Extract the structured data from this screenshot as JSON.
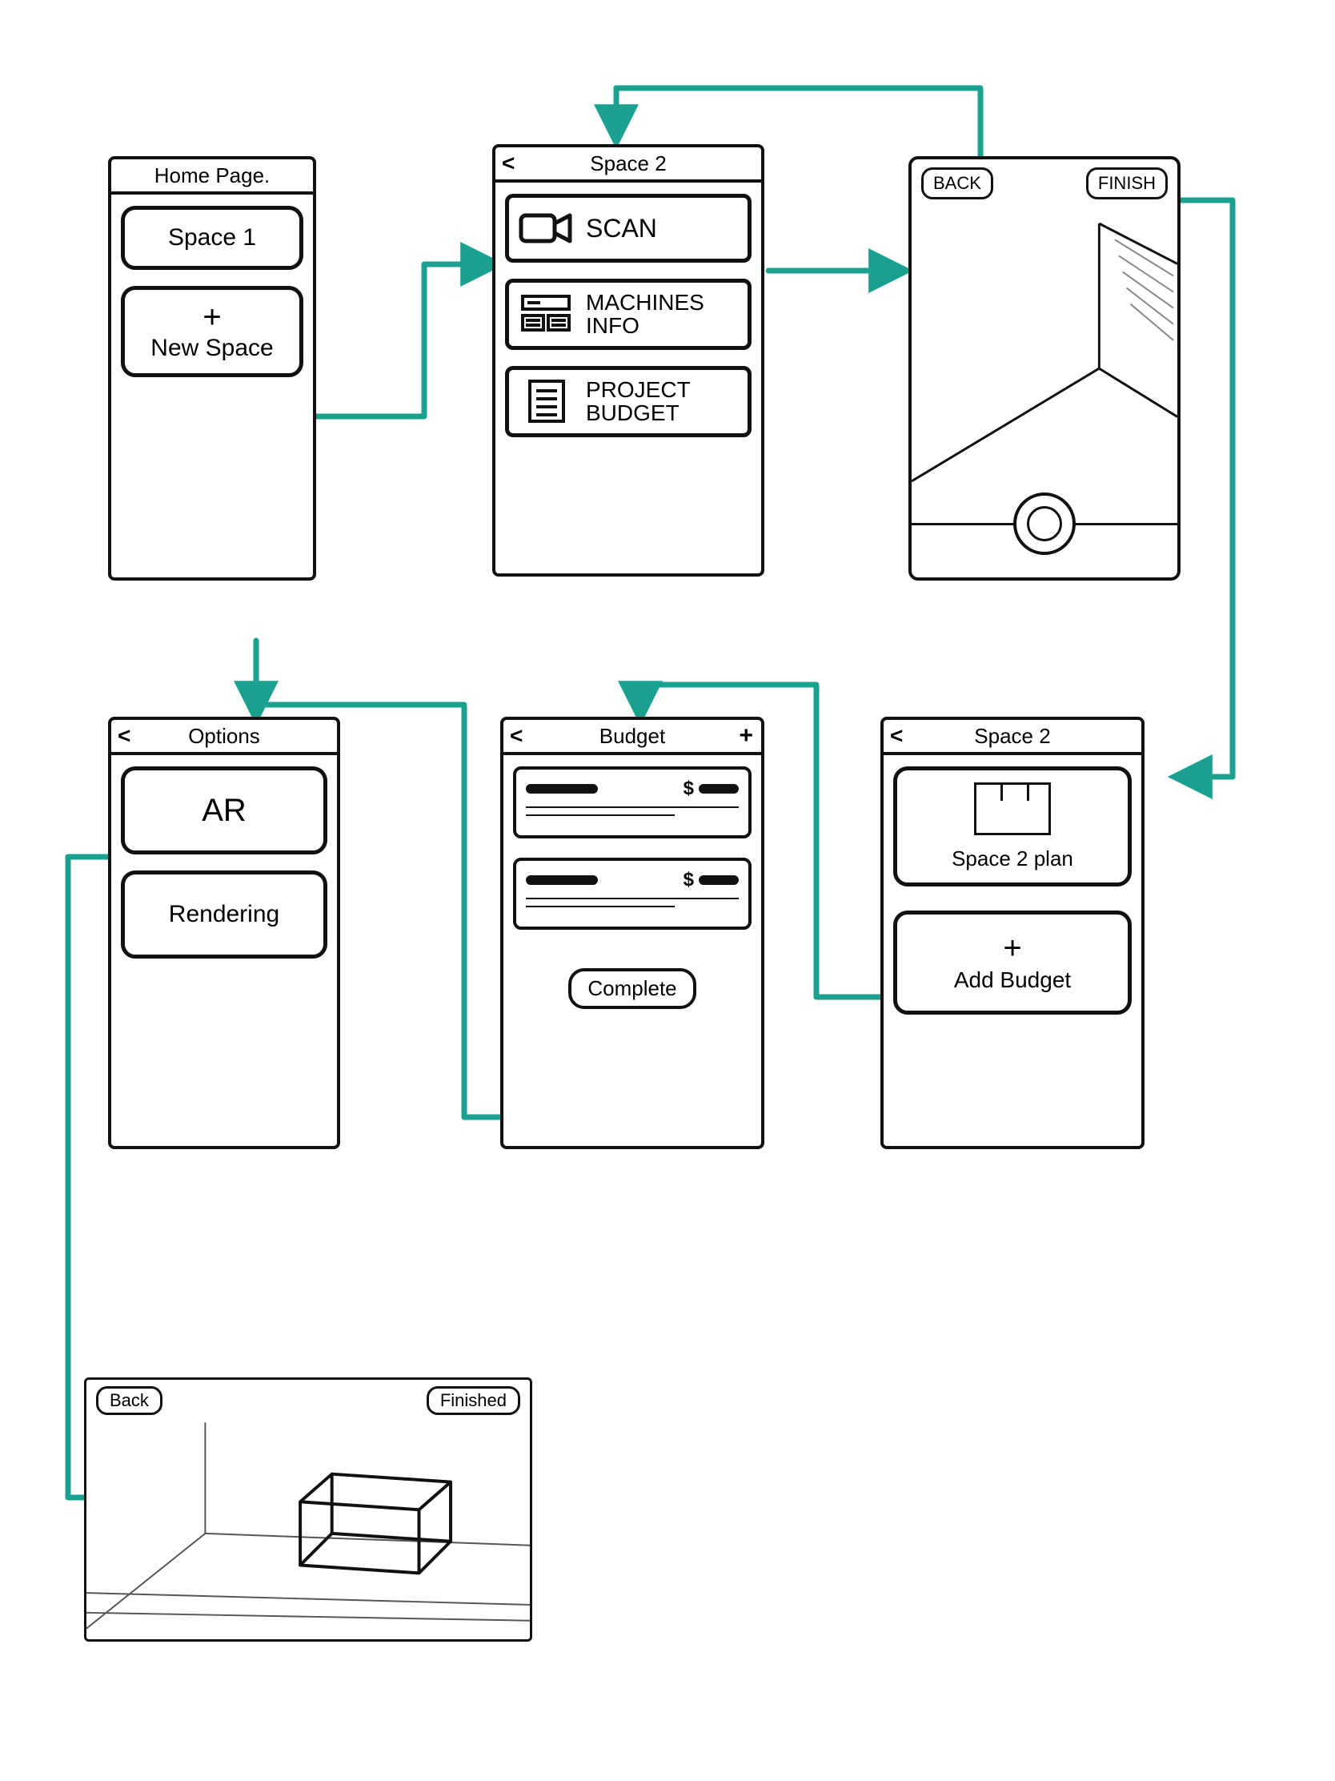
{
  "screens": {
    "home": {
      "title": "Home Page.",
      "space_card": "Space 1",
      "new_space_label": "New Space",
      "plus": "+"
    },
    "space_menu": {
      "title": "Space 2",
      "scan": "SCAN",
      "machines_line1": "MACHINES",
      "machines_line2": "INFO",
      "budget_line1": "PROJECT",
      "budget_line2": "BUDGET"
    },
    "scan": {
      "back": "BACK",
      "finish": "FINISH"
    },
    "options": {
      "title": "Options",
      "ar": "AR",
      "rendering": "Rendering"
    },
    "budget": {
      "title": "Budget",
      "price_prefix": "$",
      "complete": "Complete"
    },
    "space_plan": {
      "title": "Space 2",
      "plan_label": "Space 2 plan",
      "add_budget": "Add Budget",
      "plus": "+"
    },
    "render": {
      "back": "Back",
      "finished": "Finished"
    }
  },
  "flow_color": "#1aa190"
}
